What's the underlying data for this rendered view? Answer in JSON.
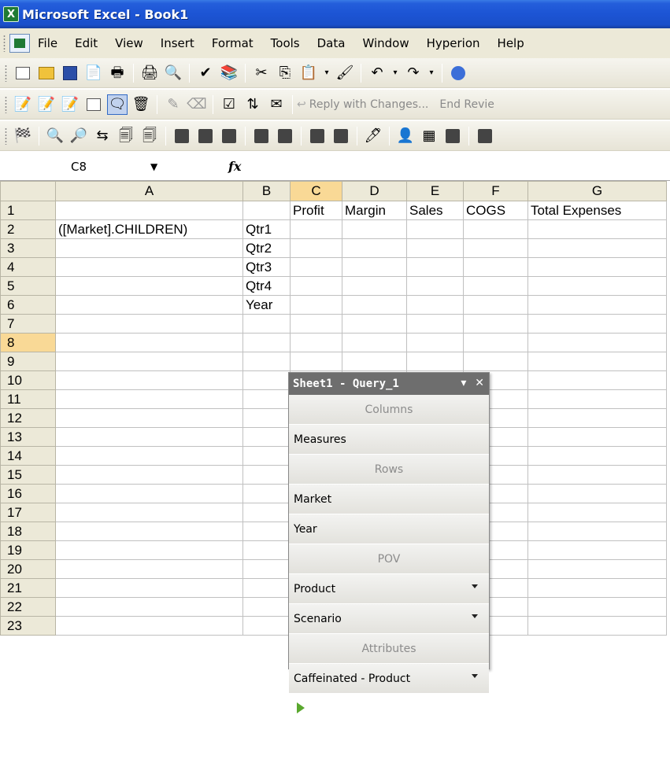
{
  "window": {
    "title": "Microsoft Excel - Book1"
  },
  "menu": {
    "items": [
      "File",
      "Edit",
      "View",
      "Insert",
      "Format",
      "Tools",
      "Data",
      "Window",
      "Hyperion",
      "Help"
    ]
  },
  "toolbar2": {
    "reply_label": "Reply with Changes...",
    "end_review_label": "End Revie"
  },
  "formula": {
    "name_box": "C8",
    "fx_label": "fx",
    "content": ""
  },
  "sheet": {
    "columns": [
      "A",
      "B",
      "C",
      "D",
      "E",
      "F",
      "G"
    ],
    "rows": [
      {
        "num": "1",
        "cells": [
          "",
          "",
          "Profit",
          "Margin",
          "Sales",
          "COGS",
          "Total Expenses"
        ]
      },
      {
        "num": "2",
        "cells": [
          "([Market].CHILDREN)",
          "Qtr1",
          "",
          "",
          "",
          "",
          ""
        ]
      },
      {
        "num": "3",
        "cells": [
          "",
          "Qtr2",
          "",
          "",
          "",
          "",
          ""
        ]
      },
      {
        "num": "4",
        "cells": [
          "",
          "Qtr3",
          "",
          "",
          "",
          "",
          ""
        ]
      },
      {
        "num": "5",
        "cells": [
          "",
          "Qtr4",
          "",
          "",
          "",
          "",
          ""
        ]
      },
      {
        "num": "6",
        "cells": [
          "",
          "Year",
          "",
          "",
          "",
          "",
          ""
        ]
      },
      {
        "num": "7",
        "cells": [
          "",
          "",
          "",
          "",
          "",
          "",
          ""
        ]
      },
      {
        "num": "8",
        "cells": [
          "",
          "",
          "",
          "",
          "",
          "",
          ""
        ]
      },
      {
        "num": "9",
        "cells": [
          "",
          "",
          "",
          "",
          "",
          "",
          ""
        ]
      },
      {
        "num": "10",
        "cells": [
          "",
          "",
          "",
          "",
          "",
          "",
          ""
        ]
      },
      {
        "num": "11",
        "cells": [
          "",
          "",
          "",
          "",
          "",
          "",
          ""
        ]
      },
      {
        "num": "12",
        "cells": [
          "",
          "",
          "",
          "",
          "",
          "",
          ""
        ]
      },
      {
        "num": "13",
        "cells": [
          "",
          "",
          "",
          "",
          "",
          "",
          ""
        ]
      },
      {
        "num": "14",
        "cells": [
          "",
          "",
          "",
          "",
          "",
          "",
          ""
        ]
      },
      {
        "num": "15",
        "cells": [
          "",
          "",
          "",
          "",
          "",
          "",
          ""
        ]
      },
      {
        "num": "16",
        "cells": [
          "",
          "",
          "",
          "",
          "",
          "",
          ""
        ]
      },
      {
        "num": "17",
        "cells": [
          "",
          "",
          "",
          "",
          "",
          "",
          ""
        ]
      },
      {
        "num": "18",
        "cells": [
          "",
          "",
          "",
          "",
          "",
          "",
          ""
        ]
      },
      {
        "num": "19",
        "cells": [
          "",
          "",
          "",
          "",
          "",
          "",
          ""
        ]
      },
      {
        "num": "20",
        "cells": [
          "",
          "",
          "",
          "",
          "",
          "",
          ""
        ]
      },
      {
        "num": "21",
        "cells": [
          "",
          "",
          "",
          "",
          "",
          "",
          ""
        ]
      },
      {
        "num": "22",
        "cells": [
          "",
          "",
          "",
          "",
          "",
          "",
          ""
        ]
      },
      {
        "num": "23",
        "cells": [
          "",
          "",
          "",
          "",
          "",
          "",
          ""
        ]
      }
    ],
    "selected_cell": "C8"
  },
  "query_panel": {
    "title": "Sheet1 - Query_1",
    "columns_header": "Columns",
    "columns_items": [
      "Measures"
    ],
    "rows_header": "Rows",
    "rows_items": [
      "Market",
      "Year"
    ],
    "pov_header": "POV",
    "pov_items": [
      "Product",
      "Scenario"
    ],
    "attributes_header": "Attributes",
    "attributes_items": [
      "Caffeinated - Product"
    ]
  },
  "colors": {
    "title_bar": "#1c54d4",
    "chrome": "#ece9d8",
    "selected_header": "#f9d996",
    "panel_title": "#6e6e6e"
  }
}
